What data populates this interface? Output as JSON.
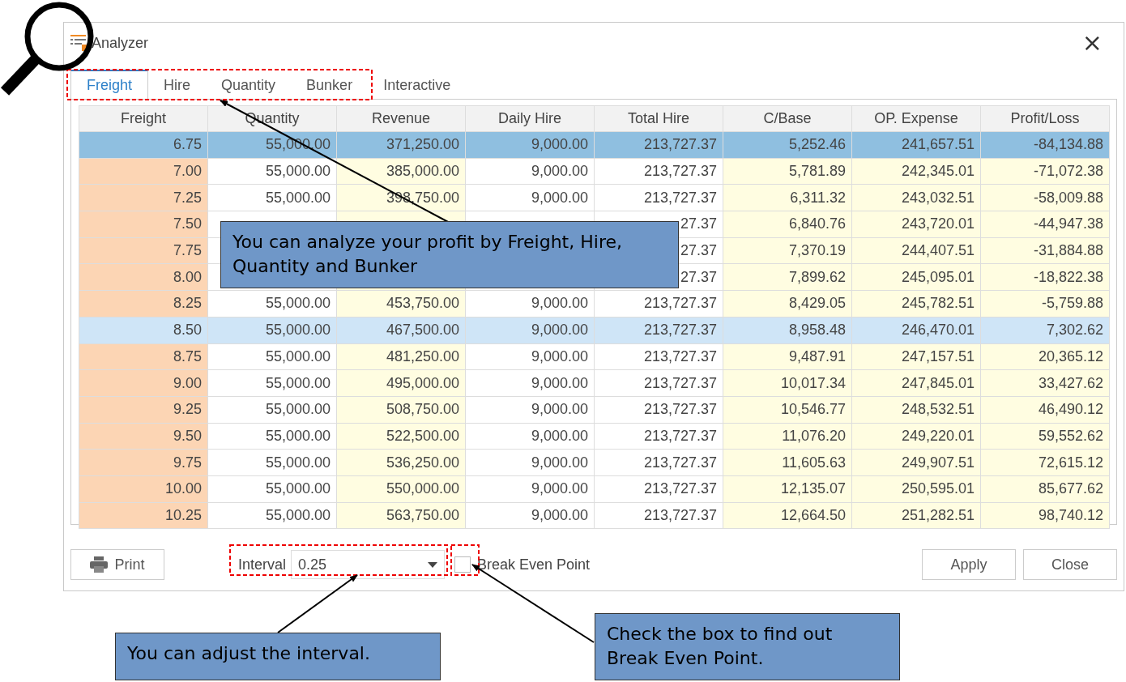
{
  "window": {
    "title": "Analyzer",
    "close": "×"
  },
  "tabs": [
    {
      "label": "Freight",
      "selected": true
    },
    {
      "label": "Hire",
      "selected": false
    },
    {
      "label": "Quantity",
      "selected": false
    },
    {
      "label": "Bunker",
      "selected": false
    },
    {
      "label": "Interactive",
      "selected": false
    }
  ],
  "table": {
    "columns": [
      {
        "label": "Freight",
        "kind": "variable"
      },
      {
        "label": "Quantity",
        "kind": "fixed"
      },
      {
        "label": "Revenue",
        "kind": "result"
      },
      {
        "label": "Daily Hire",
        "kind": "fixed"
      },
      {
        "label": "Total Hire",
        "kind": "fixed"
      },
      {
        "label": "C/Base",
        "kind": "result"
      },
      {
        "label": "OP. Expense",
        "kind": "result"
      },
      {
        "label": "Profit/Loss",
        "kind": "result"
      }
    ],
    "rows": [
      {
        "selected": true,
        "highlighted": false,
        "cells": [
          "6.75",
          "55,000.00",
          "371,250.00",
          "9,000.00",
          "213,727.37",
          "5,252.46",
          "241,657.51",
          "-84,134.88"
        ]
      },
      {
        "selected": false,
        "highlighted": false,
        "cells": [
          "7.00",
          "55,000.00",
          "385,000.00",
          "9,000.00",
          "213,727.37",
          "5,781.89",
          "242,345.01",
          "-71,072.38"
        ]
      },
      {
        "selected": false,
        "highlighted": false,
        "cells": [
          "7.25",
          "55,000.00",
          "398,750.00",
          "9,000.00",
          "213,727.37",
          "6,311.32",
          "243,032.51",
          "-58,009.88"
        ]
      },
      {
        "selected": false,
        "highlighted": false,
        "cells": [
          "7.50",
          null,
          null,
          null,
          "27.37",
          "6,840.76",
          "243,720.01",
          "-44,947.38"
        ]
      },
      {
        "selected": false,
        "highlighted": false,
        "cells": [
          "7.75",
          null,
          null,
          null,
          "27.37",
          "7,370.19",
          "244,407.51",
          "-31,884.88"
        ]
      },
      {
        "selected": false,
        "highlighted": false,
        "cells": [
          "8.00",
          null,
          null,
          null,
          "27.37",
          "7,899.62",
          "245,095.01",
          "-18,822.38"
        ]
      },
      {
        "selected": false,
        "highlighted": false,
        "cells": [
          "8.25",
          "55,000.00",
          "453,750.00",
          "9,000.00",
          "213,727.37",
          "8,429.05",
          "245,782.51",
          "-5,759.88"
        ]
      },
      {
        "selected": false,
        "highlighted": true,
        "cells": [
          "8.50",
          "55,000.00",
          "467,500.00",
          "9,000.00",
          "213,727.37",
          "8,958.48",
          "246,470.01",
          "7,302.62"
        ]
      },
      {
        "selected": false,
        "highlighted": false,
        "cells": [
          "8.75",
          "55,000.00",
          "481,250.00",
          "9,000.00",
          "213,727.37",
          "9,487.91",
          "247,157.51",
          "20,365.12"
        ]
      },
      {
        "selected": false,
        "highlighted": false,
        "cells": [
          "9.00",
          "55,000.00",
          "495,000.00",
          "9,000.00",
          "213,727.37",
          "10,017.34",
          "247,845.01",
          "33,427.62"
        ]
      },
      {
        "selected": false,
        "highlighted": false,
        "cells": [
          "9.25",
          "55,000.00",
          "508,750.00",
          "9,000.00",
          "213,727.37",
          "10,546.77",
          "248,532.51",
          "46,490.12"
        ]
      },
      {
        "selected": false,
        "highlighted": false,
        "cells": [
          "9.50",
          "55,000.00",
          "522,500.00",
          "9,000.00",
          "213,727.37",
          "11,076.20",
          "249,220.01",
          "59,552.62"
        ]
      },
      {
        "selected": false,
        "highlighted": false,
        "cells": [
          "9.75",
          "55,000.00",
          "536,250.00",
          "9,000.00",
          "213,727.37",
          "11,605.63",
          "249,907.51",
          "72,615.12"
        ]
      },
      {
        "selected": false,
        "highlighted": false,
        "cells": [
          "10.00",
          "55,000.00",
          "550,000.00",
          "9,000.00",
          "213,727.37",
          "12,135.07",
          "250,595.01",
          "85,677.62"
        ]
      },
      {
        "selected": false,
        "highlighted": false,
        "cells": [
          "10.25",
          "55,000.00",
          "563,750.00",
          "9,000.00",
          "213,727.37",
          "12,664.50",
          "251,282.51",
          "98,740.12"
        ]
      }
    ]
  },
  "footer": {
    "print": "Print",
    "interval_label": "Interval",
    "interval_value": "0.25",
    "break_even": {
      "label": "Break Even Point",
      "checked": false
    },
    "buttons": [
      "Apply",
      "Close"
    ]
  },
  "annotations": [
    {
      "text": "You can analyze your profit by Freight, Hire, Quantity and Bunker"
    },
    {
      "text": "You can adjust the interval."
    },
    {
      "text": "Check the box to find out Break Even Point."
    }
  ]
}
